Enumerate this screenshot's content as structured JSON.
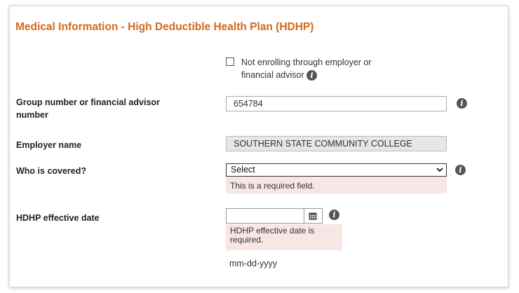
{
  "section": {
    "title": "Medical Information - High Deductible Health Plan (HDHP)"
  },
  "not_enrolling": {
    "label": "Not enrolling through employer or financial advisor",
    "checked": false
  },
  "group_number": {
    "label": "Group number or financial advisor number",
    "value": "654784"
  },
  "employer": {
    "label": "Employer name",
    "value": "SOUTHERN STATE COMMUNITY COLLEGE"
  },
  "who_covered": {
    "label": "Who is covered?",
    "selected": "Select",
    "error": "This is a required field."
  },
  "effective_date": {
    "label": "HDHP effective date",
    "value": "",
    "error": "HDHP effective date is required.",
    "format_hint": "mm-dd-yyyy"
  },
  "icons": {
    "info": "info-icon",
    "calendar": "calendar-icon",
    "dropdown": "chevron-down-icon"
  },
  "colors": {
    "title": "#d2691e",
    "error_background": "#f7e6e4",
    "readonly_background": "#e6e6e6",
    "info_icon": "#555555"
  }
}
